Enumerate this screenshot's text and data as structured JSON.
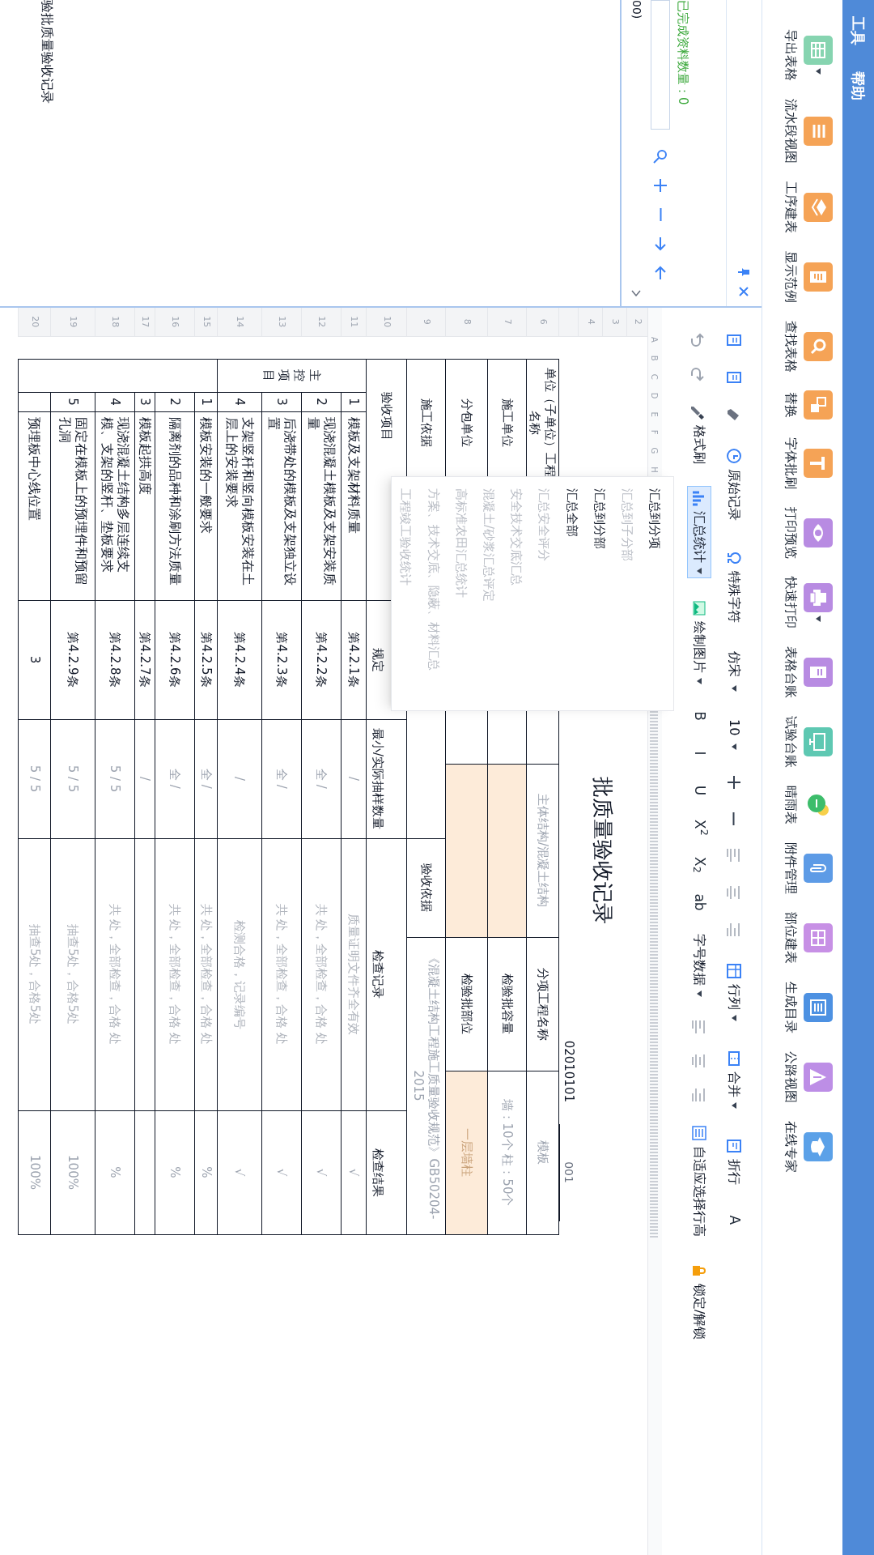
{
  "menu_bar": [
    {
      "label": "工具"
    },
    {
      "label": "帮助"
    }
  ],
  "ribbon": [
    {
      "label": "导出表格",
      "dropdown": true
    },
    {
      "label": "流水段视图",
      "dropdown": false
    },
    {
      "label": "工序建表",
      "dropdown": false
    },
    {
      "label": "显示范例",
      "dropdown": false
    },
    {
      "label": "查找表格",
      "dropdown": false
    },
    {
      "label": "替换",
      "dropdown": false
    },
    {
      "label": "字体批刷",
      "dropdown": false
    },
    {
      "label": "打印预览",
      "dropdown": false
    },
    {
      "label": "快速打印",
      "dropdown": true
    },
    {
      "label": "表格台账",
      "dropdown": false
    },
    {
      "label": "试验台账",
      "dropdown": false
    },
    {
      "label": "晴雨表",
      "dropdown": false
    },
    {
      "label": "附件管理",
      "dropdown": false
    },
    {
      "label": "部位建表",
      "dropdown": false
    },
    {
      "label": "生成目录",
      "dropdown": false
    },
    {
      "label": "公路视图",
      "dropdown": false
    },
    {
      "label": "在线专家",
      "dropdown": false
    }
  ],
  "toolbar": {
    "row_1": [
      {
        "kind": "button",
        "label": "原始记录",
        "dropdown": false
      },
      {
        "kind": "button",
        "label": "特殊字符",
        "dropdown": false
      },
      {
        "kind": "select",
        "value": "仿宋"
      },
      {
        "kind": "select",
        "value": "10"
      },
      {
        "kind": "button",
        "label": "行列",
        "dropdown": true
      },
      {
        "kind": "button",
        "label": "合并",
        "dropdown": true
      },
      {
        "kind": "button",
        "label": "折行",
        "dropdown": false
      },
      {
        "kind": "format",
        "label": "A"
      }
    ],
    "row_2": [
      {
        "kind": "button",
        "label": "格式刷",
        "dropdown": false
      },
      {
        "kind": "button",
        "label": "汇总统计",
        "dropdown": true,
        "expanded": true
      },
      {
        "kind": "button",
        "label": "绘制图片",
        "dropdown": true
      },
      {
        "kind": "format",
        "label": "B"
      },
      {
        "kind": "format",
        "label": "I"
      },
      {
        "kind": "format",
        "label": "U"
      },
      {
        "kind": "format",
        "label": "X$^{2}$"
      },
      {
        "kind": "format",
        "label": "X$_{2}$"
      },
      {
        "kind": "format",
        "label": "ab"
      },
      {
        "kind": "button",
        "label": "字号数据",
        "dropdown": true
      },
      {
        "kind": "button",
        "label": "自适应选择行高",
        "dropdown": false
      },
      {
        "kind": "button",
        "label": "锁定/解锁",
        "dropdown": false
      }
    ]
  },
  "left_panel": {
    "completed_count": "已完成资料数量：0",
    "partial_text": "00)",
    "tree_items": [
      {
        "label": "验批质量验收记录"
      }
    ]
  },
  "dropdown_menu": [
    {
      "label": "汇总到分项",
      "disabled": false
    },
    {
      "label": "汇总到子分部",
      "disabled": true
    },
    {
      "label": "汇总到分部",
      "disabled": false
    },
    {
      "label": "汇总全部",
      "disabled": false
    },
    {
      "label": "汇总安全评分",
      "disabled": true
    },
    {
      "label": "安全技术交底汇总",
      "disabled": true
    },
    {
      "label": "混凝土/砂浆汇总评定",
      "disabled": true
    },
    {
      "label": "高标准农田汇总统计",
      "disabled": true
    },
    {
      "label": "方案、技术交底、隐蔽、材料汇总",
      "disabled": true
    },
    {
      "label": "工程竣工验收统计",
      "disabled": true
    }
  ],
  "sheet": {
    "column_letters": [
      "A",
      "B",
      "C",
      "D",
      "E",
      "F",
      "G",
      "H"
    ],
    "row_numbers": [
      "2",
      "3",
      "4",
      "6",
      "7",
      "8",
      "9",
      "10",
      "11",
      "12",
      "13",
      "14",
      "15",
      "16",
      "17",
      "18",
      "19",
      "20"
    ],
    "title": "批质量验收记录",
    "code": "02010101",
    "serial": "001",
    "header_rows": [
      {
        "cells": [
          {
            "kind": "label",
            "text": "单位（子单位）工程名称"
          },
          {
            "kind": "value"
          },
          {
            "kind": "label"
          },
          {
            "kind": "value",
            "text": "主体结构/混凝土结构",
            "highlighted": false
          },
          {
            "kind": "label",
            "text": "分项工程名称"
          },
          {
            "kind": "value",
            "text": "模板",
            "highlighted": false
          }
        ]
      },
      {
        "cells": [
          {
            "kind": "label",
            "text": "施工单位"
          },
          {
            "kind": "value"
          },
          {
            "kind": "label"
          },
          {
            "kind": "value",
            "highlighted": true
          },
          {
            "kind": "label",
            "text": "检验批容量"
          },
          {
            "kind": "value",
            "text": "墙：10个 柱：50个",
            "highlighted": false
          }
        ]
      },
      {
        "cells": [
          {
            "kind": "label",
            "text": "分包单位"
          },
          {
            "kind": "value"
          },
          {
            "kind": "label"
          },
          {
            "kind": "value",
            "highlighted": true
          },
          {
            "kind": "label",
            "text": "检验批部位"
          },
          {
            "kind": "value",
            "text": "一层墙柱",
            "highlighted": true
          }
        ]
      },
      {
        "cells": [
          {
            "kind": "label",
            "text": "施工依据"
          },
          {
            "kind": "value"
          },
          {
            "kind": "label",
            "text": "验收依据"
          },
          {
            "kind": "value",
            "text": "《混凝土结构工程施工质量验收规范》GB50204-2015",
            "highlighted": false
          }
        ]
      }
    ],
    "column_headers": [
      "验收项目",
      "规定",
      "最小/实际抽样数量",
      "检查记录",
      "检查结果"
    ],
    "sections": [
      {
        "label": "主控项目",
        "items": [
          {
            "number": "1",
            "text": "模板及支架材料质量",
            "clause": "第4.2.1条",
            "sample": "/",
            "record": "质量证明文件齐全有效",
            "result": "√"
          },
          {
            "number": "2",
            "text": "现浇混凝土模板及支架安装质量",
            "clause": "第4.2.2条",
            "sample": "全 /",
            "record": "共 处，全部检查，合格 处",
            "result": "√"
          },
          {
            "number": "3",
            "text": "后浇带处的模板及支架独立设置",
            "clause": "第4.2.3条",
            "sample": "全 /",
            "record": "共 处，全部检查，合格 处",
            "result": "√"
          },
          {
            "number": "4",
            "text": "支架竖杆和竖向模板安装在土层上的安装要求",
            "clause": "第4.2.4条",
            "sample": "/",
            "record": "检测合格，记录编号",
            "result": "√"
          }
        ]
      },
      {
        "items": [
          {
            "number": "1",
            "text": "模板安装的一般要求",
            "clause": "第4.2.5条",
            "sample": "全 /",
            "record": "共 处，全部检查，合格 处",
            "result": "%"
          },
          {
            "number": "2",
            "text": "隔离剂的品种和涂刷方法质量",
            "clause": "第4.2.6条",
            "sample": "全 /",
            "record": "共 处，全部检查，合格 处",
            "result": "%"
          },
          {
            "number": "3",
            "text": "模板起拱高度",
            "clause": "第4.2.7条",
            "sample": "/"
          },
          {
            "number": "4",
            "text": "现浇混凝土结构多层连续支模、支架的竖杆、垫板要求",
            "clause": "第4.2.8条",
            "sample": "5 / 5",
            "record": "共 处，全部检查，合格 处",
            "result": "%"
          },
          {
            "number": "5",
            "text": "固定在模板上的预埋件和预留孔洞",
            "clause": "第4.2.9条",
            "sample": "5 / 5",
            "record": "抽查5处，合格5处",
            "result": "100%"
          },
          {
            "text": "预埋板中心线位置",
            "clause": "3",
            "sample": "5 / 5",
            "record": "抽查5处，合格5处",
            "result": "100%"
          }
        ]
      }
    ]
  }
}
